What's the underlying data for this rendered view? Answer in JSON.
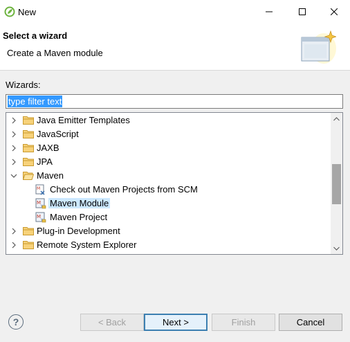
{
  "window": {
    "title": "New",
    "controls": {
      "minimize": "minimize-icon",
      "maximize": "maximize-icon",
      "close": "close-icon"
    }
  },
  "banner": {
    "title": "Select a wizard",
    "description": "Create a Maven module",
    "image": "wizard-banner-icon"
  },
  "wizards": {
    "label": "Wizards:",
    "filter_value": "type filter text"
  },
  "tree": {
    "items": [
      {
        "label": "Java Emitter Templates",
        "type": "folder",
        "expanded": false
      },
      {
        "label": "JavaScript",
        "type": "folder",
        "expanded": false
      },
      {
        "label": "JAXB",
        "type": "folder",
        "expanded": false
      },
      {
        "label": "JPA",
        "type": "folder",
        "expanded": false
      },
      {
        "label": "Maven",
        "type": "folder",
        "expanded": true
      },
      {
        "label": "Check out Maven Projects from SCM",
        "type": "wizard",
        "selected": false
      },
      {
        "label": "Maven Module",
        "type": "wizard",
        "selected": true
      },
      {
        "label": "Maven Project",
        "type": "wizard",
        "selected": false
      },
      {
        "label": "Plug-in Development",
        "type": "folder",
        "expanded": false
      },
      {
        "label": "Remote System Explorer",
        "type": "folder",
        "expanded": false
      }
    ]
  },
  "buttons": {
    "help": "?",
    "back": "< Back",
    "next": "Next >",
    "finish": "Finish",
    "cancel": "Cancel"
  },
  "colors": {
    "selection": "#3399ff",
    "tree_selection": "#cce8ff",
    "default_button_border": "#3c7fb1",
    "folder": "#e8b94a"
  }
}
